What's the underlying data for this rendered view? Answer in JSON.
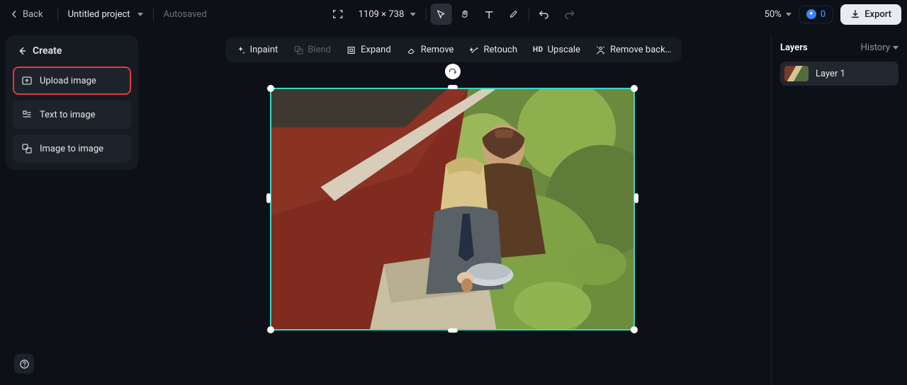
{
  "topbar": {
    "back_label": "Back",
    "project_name": "Untitled project",
    "autosaved_label": "Autosaved",
    "dimensions": "1109 × 738",
    "zoom": "50%",
    "credits": "0",
    "export_label": "Export"
  },
  "create": {
    "header": "Create",
    "items": [
      {
        "label": "Upload image",
        "highlight": true
      },
      {
        "label": "Text to image",
        "highlight": false
      },
      {
        "label": "Image to image",
        "highlight": false
      }
    ]
  },
  "actions": {
    "inpaint": "Inpaint",
    "blend": "Blend",
    "expand": "Expand",
    "remove": "Remove",
    "retouch": "Retouch",
    "upscale": "Upscale",
    "remove_bg": "Remove back…"
  },
  "layers": {
    "panel_title": "Layers",
    "history_label": "History",
    "items": [
      {
        "label": "Layer 1"
      }
    ]
  }
}
